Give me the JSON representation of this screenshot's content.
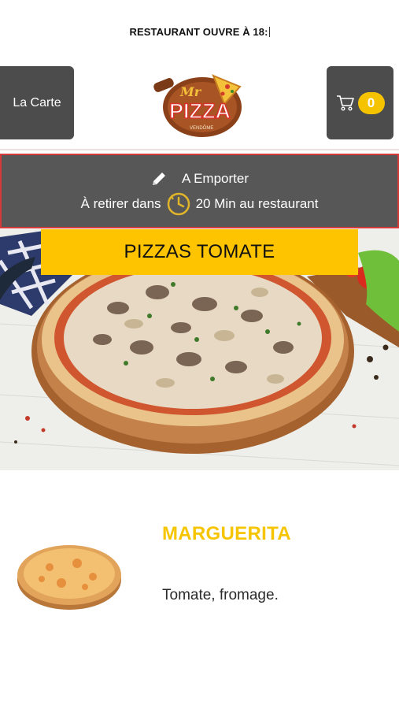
{
  "notice": {
    "text": "RESTAURANT OUVRE À 18:"
  },
  "header": {
    "carte_label": "La Carte",
    "logo": {
      "script": "Mr",
      "word": "PIZZA",
      "sub": "VENDÔME"
    },
    "cart_count": "0"
  },
  "order": {
    "mode": "A Emporter",
    "pickup_prefix": "À retirer dans",
    "pickup_suffix": "20 Min au restaurant"
  },
  "category": {
    "title": "PIZZAS TOMATE"
  },
  "product": {
    "name": "MARGUERITA",
    "description": "Tomate, fromage."
  },
  "colors": {
    "accent_yellow": "#ffc400",
    "dark_button": "#4c4c4c",
    "order_border": "#d53a3a"
  },
  "icons": {
    "cart": "cart-icon",
    "mode": "pencil-icon",
    "time": "clock-icon"
  }
}
